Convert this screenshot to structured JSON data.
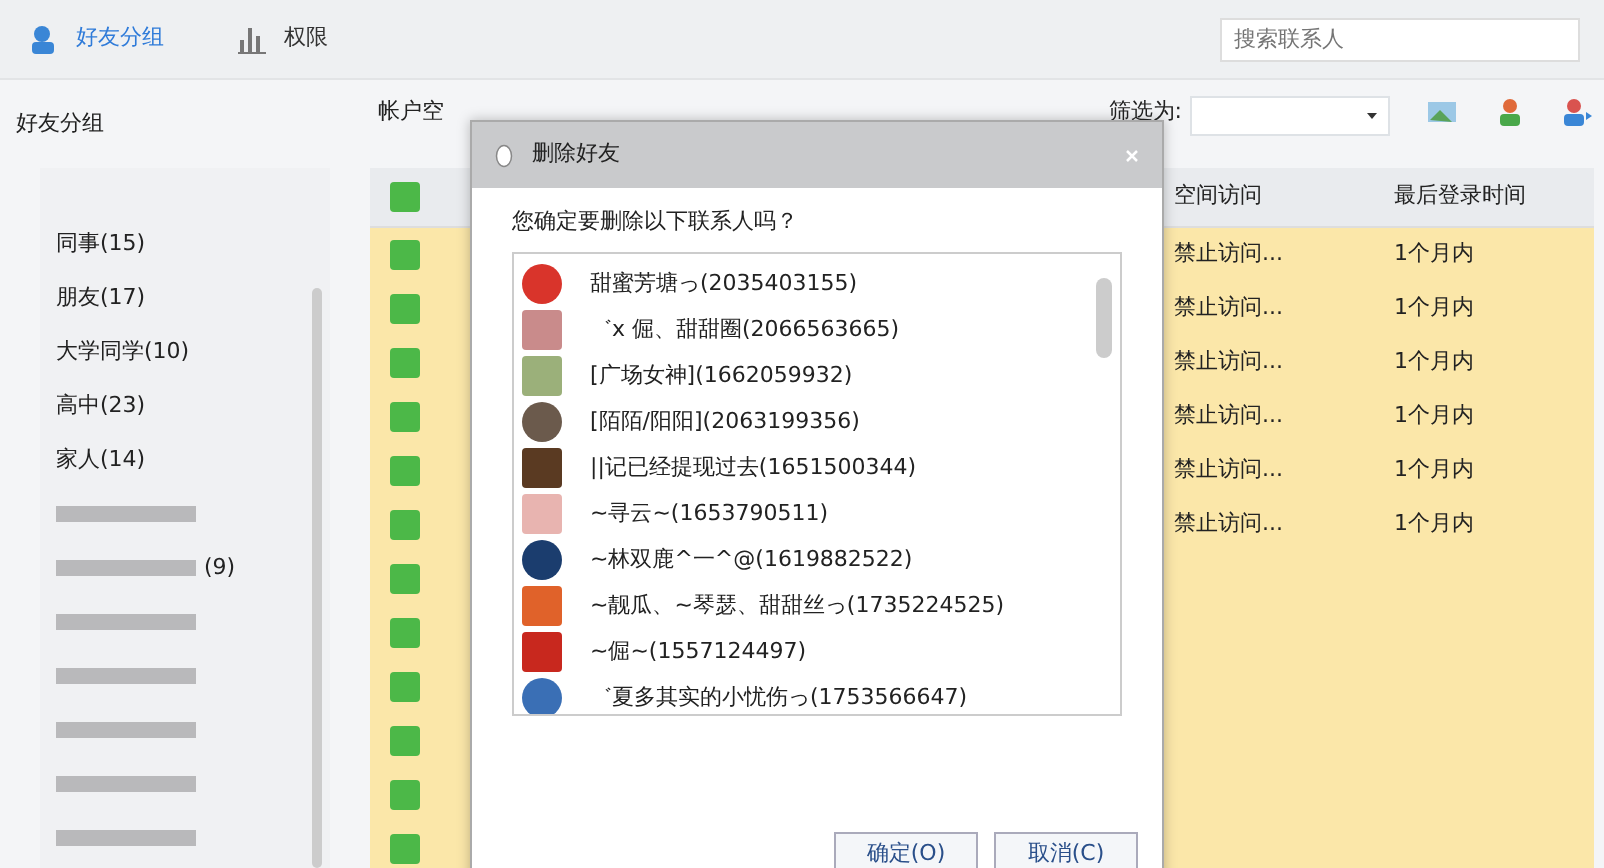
{
  "toolbar": {
    "tabs": [
      {
        "label": "好友分组",
        "selected": true
      },
      {
        "label": "权限",
        "selected": false
      }
    ],
    "search": {
      "placeholder": "搜索联系人"
    }
  },
  "sidebar": {
    "title": "好友分组",
    "items": [
      {
        "kind": "group",
        "label": "同事(15)"
      },
      {
        "kind": "group",
        "label": "朋友(17)"
      },
      {
        "kind": "group",
        "label": "大学同学(10)"
      },
      {
        "kind": "group",
        "label": "高中(23)"
      },
      {
        "kind": "group",
        "label": "家人(14)"
      },
      {
        "kind": "redacted"
      },
      {
        "kind": "redacted",
        "label": "(9)"
      },
      {
        "kind": "redacted"
      },
      {
        "kind": "redacted"
      },
      {
        "kind": "redacted"
      },
      {
        "kind": "redacted"
      },
      {
        "kind": "redacted"
      }
    ]
  },
  "main": {
    "caption": "帐户空",
    "filter_label": "筛选为:",
    "table": {
      "header_checked": true,
      "columns": [
        "空间访问",
        "最后登录时间"
      ],
      "rows": [
        {
          "checked": true,
          "column_access": "禁止访问...",
          "last_login": "1个月内"
        },
        {
          "checked": true,
          "column_access": "禁止访问...",
          "last_login": "1个月内"
        },
        {
          "checked": true,
          "column_access": "禁止访问...",
          "last_login": "1个月内"
        },
        {
          "checked": true,
          "column_access": "禁止访问...",
          "last_login": "1个月内"
        },
        {
          "checked": true,
          "column_access": "禁止访问...",
          "last_login": "1个月内"
        },
        {
          "checked": true,
          "column_access": "禁止访问...",
          "last_login": "1个月内"
        },
        {
          "checked": true
        },
        {
          "checked": true
        },
        {
          "checked": true
        },
        {
          "checked": true
        },
        {
          "checked": true
        },
        {
          "checked": true
        }
      ]
    }
  },
  "dialog": {
    "title": "删除好友",
    "question": "您确定要删除以下联系人吗？",
    "contacts": [
      {
        "name": "甜蜜芳塘っ(2035403155)",
        "color": "#d9342b"
      },
      {
        "name": "゛ⅹ 倔、甜甜圈(2066563665)",
        "color": "#c98b8b"
      },
      {
        "name": "[广场女神](1662059932)",
        "color": "#9bb07a"
      },
      {
        "name": "[陌陌/阳阳](2063199356)",
        "color": "#6b5a4c"
      },
      {
        "name": "||记已经提现过去(1651500344)",
        "color": "#5a3a22"
      },
      {
        "name": "~寻云~(1653790511)",
        "color": "#e8b4b0"
      },
      {
        "name": "~林双鹿^一^@(1619882522)",
        "color": "#1b3d6e"
      },
      {
        "name": "~靓瓜、~琴瑟、甜甜丝っ(1735224525)",
        "color": "#e0622a"
      },
      {
        "name": "~倔~(1557124497)",
        "color": "#c8281e"
      },
      {
        "name": "゛夏多其实的小忧伤っ(1753566647)",
        "color": "#3a6fb5"
      }
    ],
    "buttons": [
      "确定(O)",
      "取消(C)"
    ]
  }
}
